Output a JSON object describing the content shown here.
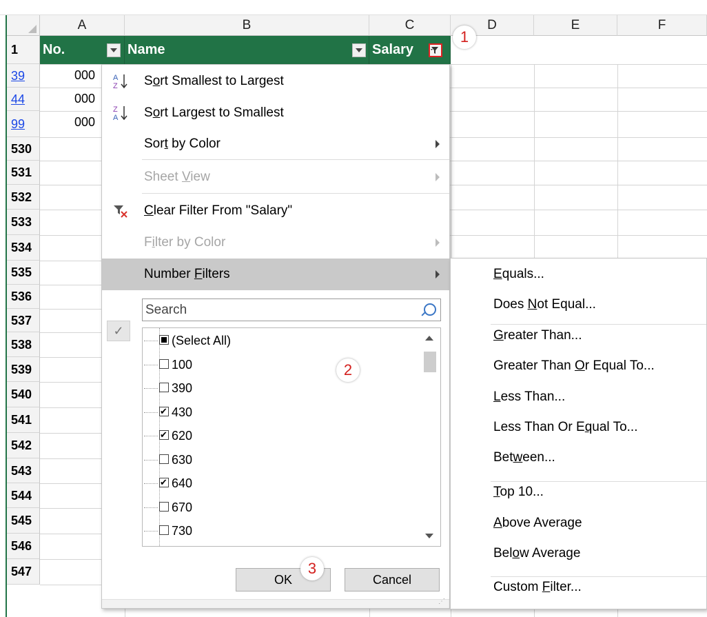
{
  "columns": [
    "A",
    "B",
    "C",
    "D",
    "E",
    "F"
  ],
  "header_row": {
    "row_number": "1",
    "col_a": "No.",
    "col_b": "Name",
    "col_c": "Salary"
  },
  "rows": [
    {
      "num": "39",
      "a": "000"
    },
    {
      "num": "44",
      "a": "000"
    },
    {
      "num": "99",
      "a": "000"
    },
    {
      "num": "530"
    },
    {
      "num": "531"
    },
    {
      "num": "532"
    },
    {
      "num": "533"
    },
    {
      "num": "534"
    },
    {
      "num": "535"
    },
    {
      "num": "536"
    },
    {
      "num": "537"
    },
    {
      "num": "538"
    },
    {
      "num": "539"
    },
    {
      "num": "540"
    },
    {
      "num": "541"
    },
    {
      "num": "542"
    },
    {
      "num": "543"
    },
    {
      "num": "544"
    },
    {
      "num": "545"
    },
    {
      "num": "546"
    },
    {
      "num": "547"
    }
  ],
  "callouts": [
    "1",
    "2",
    "3"
  ],
  "menu": {
    "sort_asc": {
      "pre": "S",
      "ul": "o",
      "post": "rt Smallest to Largest"
    },
    "sort_desc": {
      "pre": "S",
      "ul": "o",
      "post": "rt Largest to Smallest"
    },
    "sort_color": {
      "pre": "Sor",
      "ul": "t",
      "post": " by Color"
    },
    "sheet_view": {
      "pre": "Sheet ",
      "ul": "V",
      "post": "iew"
    },
    "clear_filter": {
      "pre": "",
      "ul": "C",
      "post": "lear Filter From \"Salary\""
    },
    "filter_color": {
      "pre": "F",
      "ul": "i",
      "post": "lter by Color"
    },
    "number_filters": {
      "pre": "Number ",
      "ul": "F",
      "post": "ilters"
    },
    "search_placeholder": "Search",
    "list_items": [
      {
        "label": "(Select All)",
        "state": "indeterminate"
      },
      {
        "label": "100",
        "state": "unchecked"
      },
      {
        "label": "390",
        "state": "unchecked"
      },
      {
        "label": "430",
        "state": "checked"
      },
      {
        "label": "620",
        "state": "checked"
      },
      {
        "label": "630",
        "state": "unchecked"
      },
      {
        "label": "640",
        "state": "checked"
      },
      {
        "label": "670",
        "state": "unchecked"
      },
      {
        "label": "730",
        "state": "unchecked"
      }
    ],
    "ok_label": "OK",
    "cancel_label": "Cancel"
  },
  "submenu": [
    {
      "pre": "",
      "ul": "E",
      "post": "quals..."
    },
    {
      "pre": "Does ",
      "ul": "N",
      "post": "ot Equal..."
    },
    {
      "pre": "",
      "ul": "G",
      "post": "reater Than..."
    },
    {
      "pre": "Greater Than ",
      "ul": "O",
      "post": "r Equal To..."
    },
    {
      "pre": "",
      "ul": "L",
      "post": "ess Than..."
    },
    {
      "pre": "Less Than Or E",
      "ul": "q",
      "post": "ual To..."
    },
    {
      "pre": "Bet",
      "ul": "w",
      "post": "een..."
    },
    {
      "pre": "",
      "ul": "T",
      "post": "op 10..."
    },
    {
      "pre": "",
      "ul": "A",
      "post": "bove Average"
    },
    {
      "pre": "Bel",
      "ul": "o",
      "post": "w Average"
    },
    {
      "pre": "Custom ",
      "ul": "F",
      "post": "ilter..."
    }
  ],
  "colors": {
    "header_green": "#217346",
    "callout_red": "#d3201e",
    "filtered_row_blue": "#1a47e6",
    "hover_gray": "#c9c9c9"
  }
}
